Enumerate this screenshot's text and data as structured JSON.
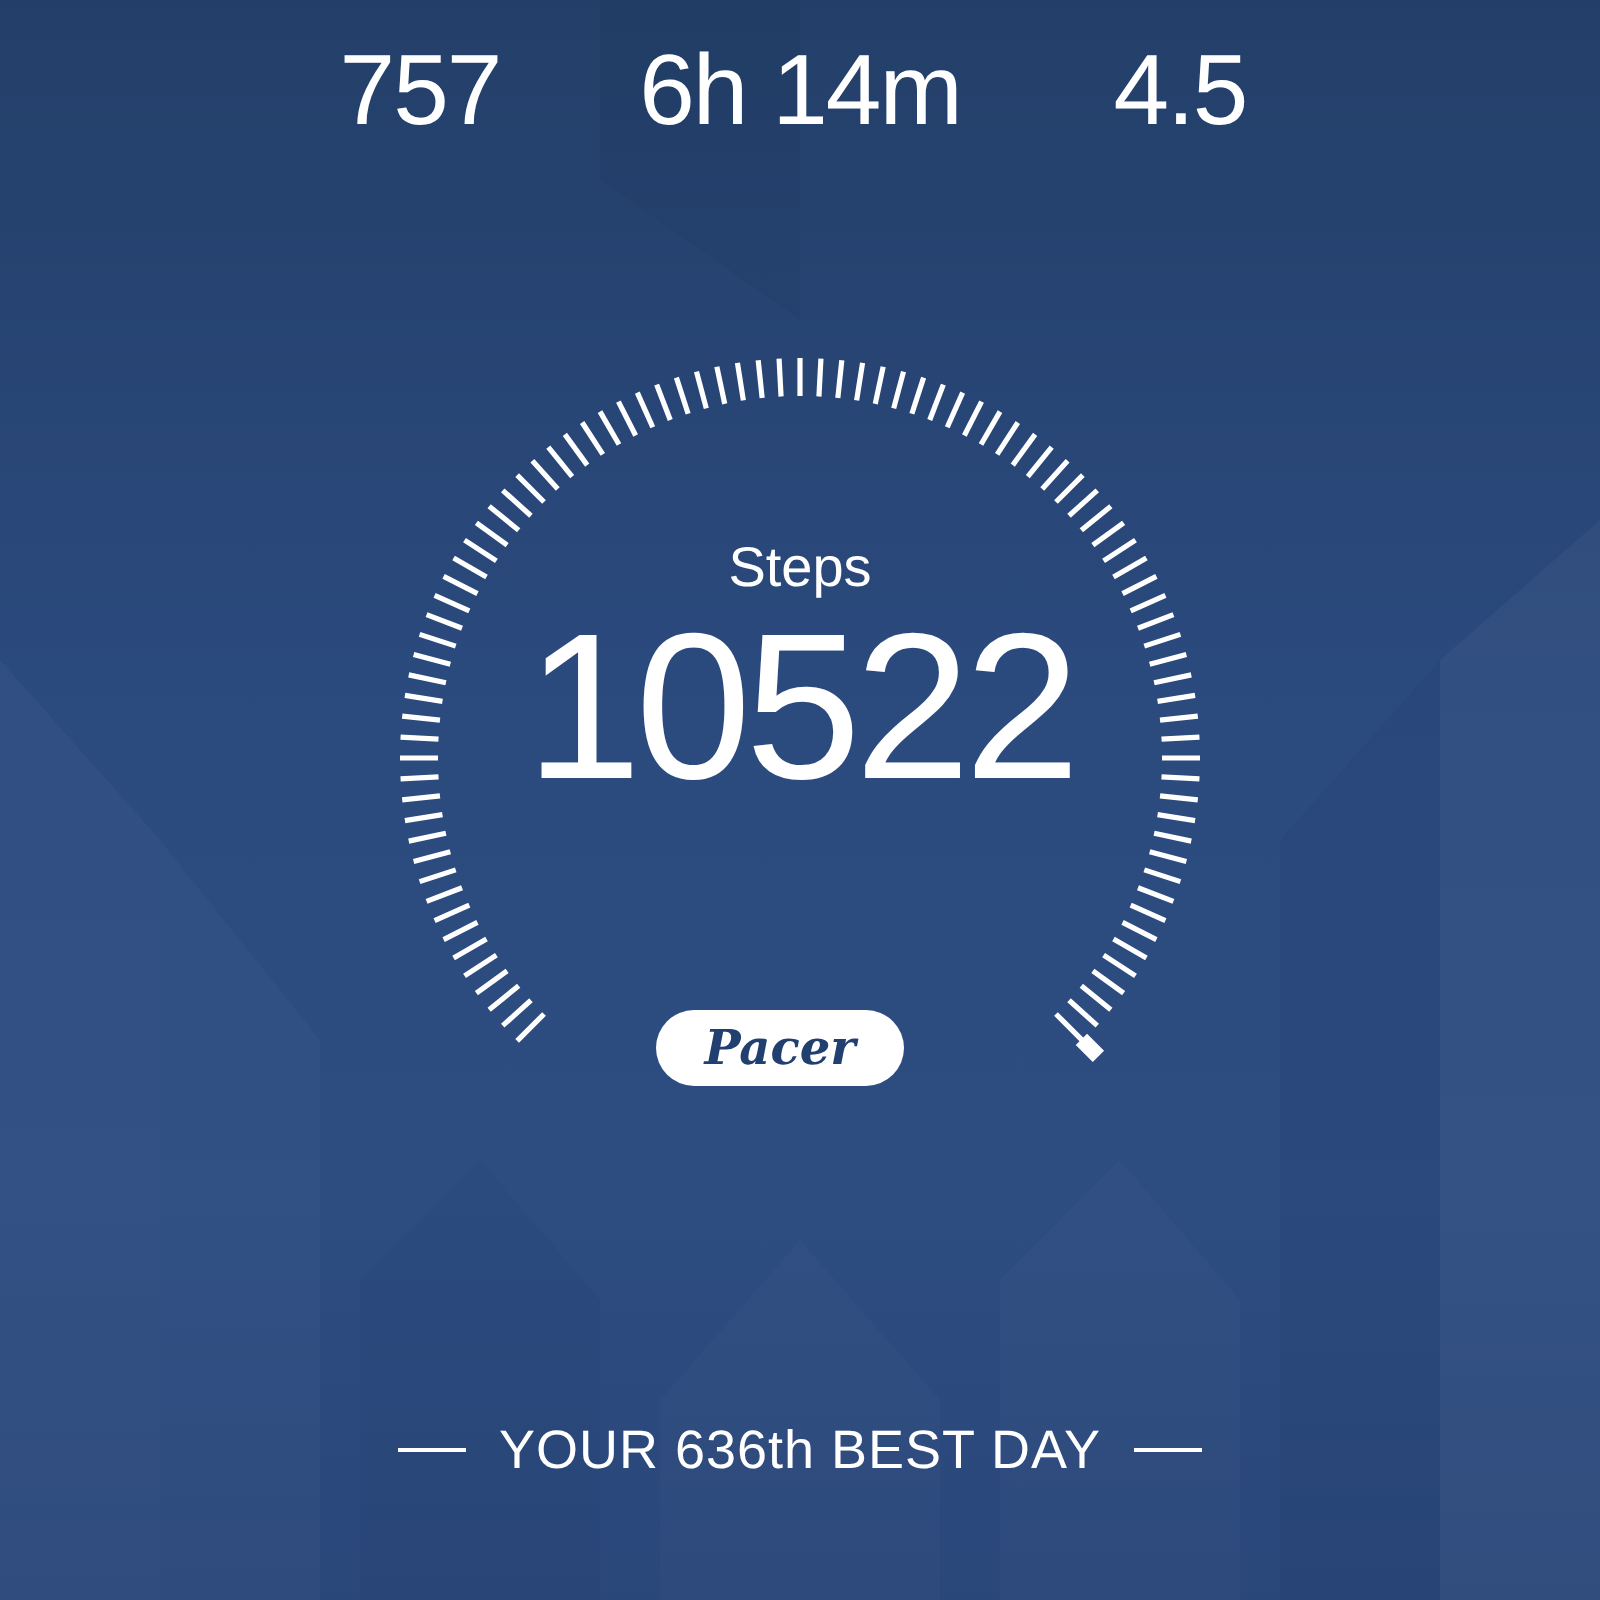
{
  "stats": [
    {
      "value": "757"
    },
    {
      "value": "6h 14m"
    },
    {
      "value": "4.5"
    }
  ],
  "gauge": {
    "label": "Steps",
    "value": "10522"
  },
  "brand": "Pacer",
  "footer": "YOUR 636th BEST DAY"
}
